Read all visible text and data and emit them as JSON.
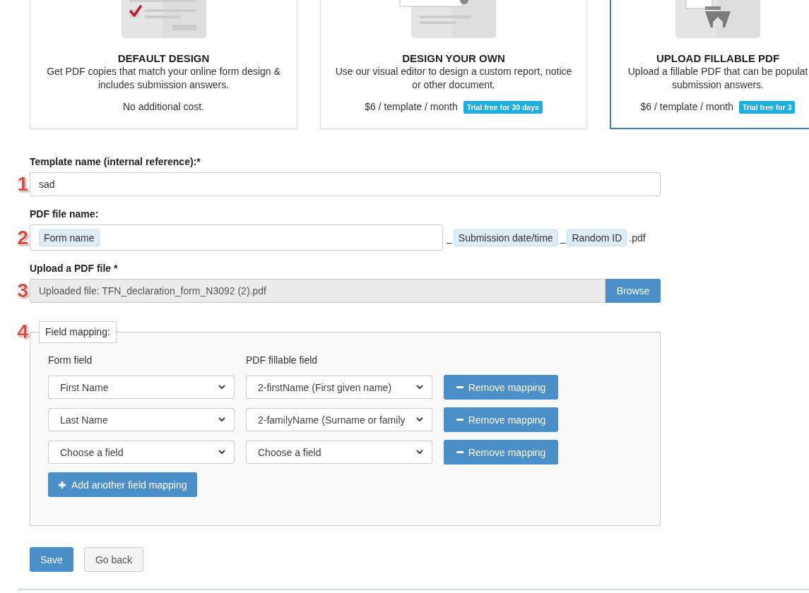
{
  "cards": [
    {
      "kind": "default",
      "title": "DEFAULT DESIGN",
      "description": [
        "Get PDF copies that match your online form design &",
        "includes submission answers."
      ],
      "price": "No additional cost.",
      "selected": false
    },
    {
      "kind": "custom",
      "title": "DESIGN YOUR OWN",
      "description": [
        "Use our visual editor to design a custom report, notice",
        "or other document."
      ],
      "price": "$6 / template / month",
      "badge": "Trial free for 30 days",
      "selected": false
    },
    {
      "kind": "upload",
      "title": "UPLOAD FILLABLE PDF",
      "description": [
        "Upload a fillable PDF that can be populat",
        "submission answers."
      ],
      "price": "$6 / template / month",
      "badge": "Trial free for 3",
      "selected": true
    }
  ],
  "template_name": {
    "marker": "1",
    "label": "Template name (internal reference):*",
    "value": "sad"
  },
  "pdf_file_name": {
    "marker": "2",
    "label": "PDF file name:",
    "tokens": [
      "Form name"
    ],
    "suffix": [
      {
        "kind": "separator",
        "text": "_"
      },
      {
        "kind": "token",
        "text": "Submission date/time"
      },
      {
        "kind": "separator",
        "text": "_"
      },
      {
        "kind": "token",
        "text": "Random ID"
      },
      {
        "kind": "separator",
        "text": ".pdf"
      }
    ]
  },
  "upload": {
    "marker": "3",
    "label": "Upload a PDF file *",
    "value": "Uploaded file: TFN_declaration_form_N3092 (2).pdf",
    "readonly": true,
    "button": "Browse"
  },
  "field_mapping": {
    "marker": "4",
    "legend": "Field mapping:",
    "columns": [
      "Form field",
      "PDF fillable field"
    ],
    "rows": [
      {
        "form_field": "First Name",
        "pdf_field": "2-firstName (First given name)",
        "remove": "Remove mapping"
      },
      {
        "form_field": "Last Name",
        "pdf_field": "2-familyName (Surname or family",
        "remove": "Remove mapping"
      },
      {
        "form_field": "Choose a field",
        "pdf_field": "Choose a field",
        "remove": "Remove mapping"
      }
    ],
    "add_button": "Add another field mapping"
  },
  "actions": [
    {
      "kind": "primary",
      "label": "Save"
    },
    {
      "kind": "secondary",
      "label": "Go back"
    }
  ]
}
